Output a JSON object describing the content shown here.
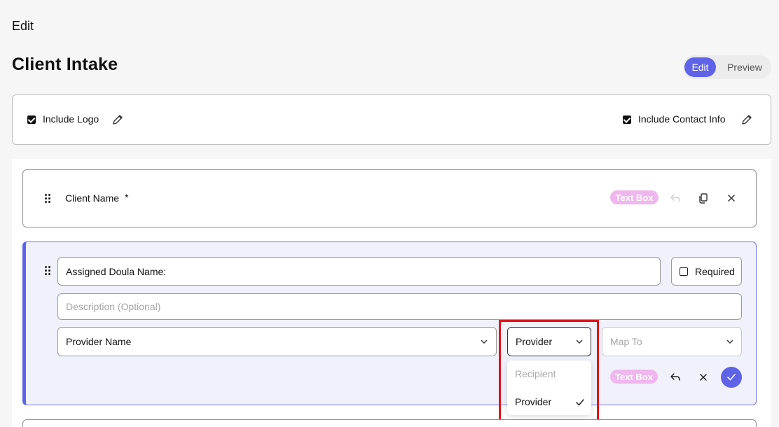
{
  "breadcrumb": "Edit",
  "page_title": "Client Intake",
  "mode_toggle": {
    "edit": "Edit",
    "preview": "Preview",
    "active": "Edit"
  },
  "header_options": {
    "include_logo": {
      "label": "Include Logo",
      "checked": true
    },
    "include_contact": {
      "label": "Include Contact Info",
      "checked": true
    }
  },
  "fields": [
    {
      "label": "Client Name",
      "required_mark": "*",
      "type_badge": "Text Box"
    },
    {
      "label_value": "Assigned Doula Name:",
      "required_label": "Required",
      "required_checked": false,
      "description_placeholder": "Description (Optional)",
      "source_select": "Provider Name",
      "role_select": "Provider",
      "map_to_placeholder": "Map To",
      "type_badge": "Text Box"
    }
  ],
  "role_dropdown": {
    "options": [
      "Recipient",
      "Provider"
    ],
    "selected": "Provider"
  },
  "colors": {
    "accent": "#5f63e8",
    "badge": "#f0b6ee",
    "highlight": "#e0141c"
  }
}
